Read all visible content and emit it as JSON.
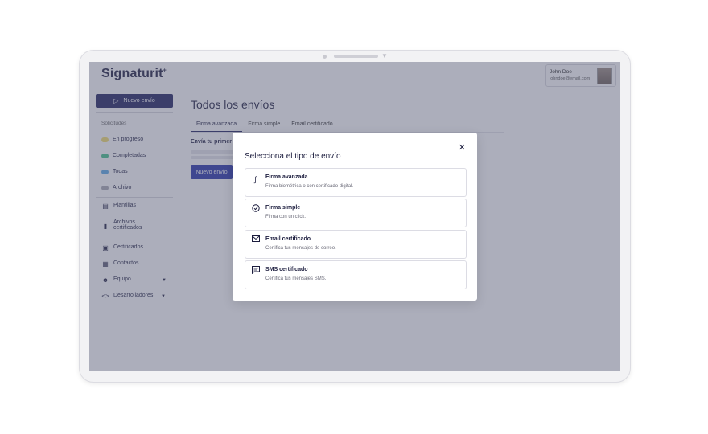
{
  "app": {
    "logo": "Signaturit",
    "logo_mark": "+"
  },
  "user": {
    "name": "John Doe",
    "email": "johndoe@email.com"
  },
  "sidebar": {
    "new_button": "Nuevo envío",
    "section_label": "Solicitudes",
    "requests": [
      {
        "label": "En progreso",
        "color": "#f3dd6b"
      },
      {
        "label": "Completadas",
        "color": "#42c28a"
      },
      {
        "label": "Todas",
        "color": "#5aa9e6"
      },
      {
        "label": "Archivo",
        "color": "#a9a9b3"
      }
    ],
    "items": [
      {
        "label": "Plantillas",
        "icon": "template-icon"
      },
      {
        "label": "Archivos",
        "label2": "certificados",
        "icon": "file-icon"
      },
      {
        "label": "Certificados",
        "icon": "certificate-icon"
      },
      {
        "label": "Contactos",
        "icon": "contacts-icon"
      },
      {
        "label": "Equipo",
        "icon": "team-icon"
      },
      {
        "label": "Desarrolladores",
        "icon": "code-icon"
      }
    ]
  },
  "main": {
    "title": "Todos los envíos",
    "tabs": [
      "Firma avanzada",
      "Firma simple",
      "Email certificado"
    ],
    "empty_text": "Envía tu primer",
    "button": "Nuevo envío"
  },
  "modal": {
    "title": "Selecciona el tipo de envío",
    "close": "✕",
    "options": [
      {
        "title": "Firma avanzada",
        "desc": "Firma biométrica o con certificado digital.",
        "icon": "signature-icon"
      },
      {
        "title": "Firma simple",
        "desc": "Firma con un click.",
        "icon": "check-circle-icon"
      },
      {
        "title": "Email certificado",
        "desc": "Certifica tus mensajes de correo.",
        "icon": "envelope-icon"
      },
      {
        "title": "SMS certificado",
        "desc": "Certifica tus mensajes SMS.",
        "icon": "chat-icon"
      }
    ]
  },
  "colors": {
    "brand_dark": "#1c1f5c",
    "primary": "#2430a8"
  }
}
